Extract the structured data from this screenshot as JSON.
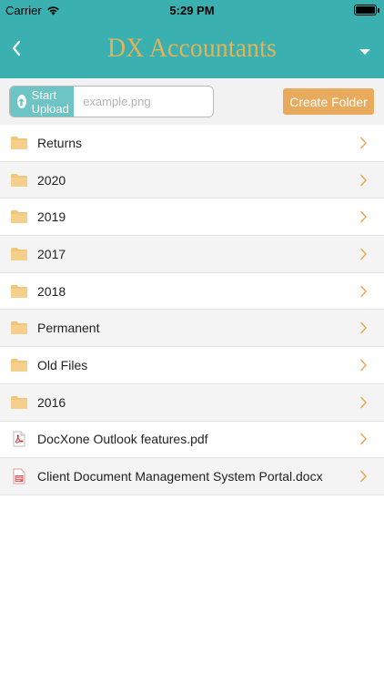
{
  "status_bar": {
    "carrier": "Carrier",
    "time": "5:29 PM",
    "battery_level": 1.0
  },
  "nav": {
    "title": "DX Accountants",
    "back_icon": "chevron-left-icon",
    "menu_icon": "caret-down-icon"
  },
  "toolbar": {
    "upload_label": "Start Upload",
    "file_placeholder": "example.png",
    "create_folder_label": "Create Folder"
  },
  "colors": {
    "header": "#3bb0b0",
    "title_gold": "#e3b25a",
    "upload_button": "#6cc4c4",
    "create_folder_button": "#e8aa5c",
    "folder_icon": "#f0c77a",
    "chevron": "#e8aa5c"
  },
  "items": [
    {
      "label": "Returns",
      "type": "folder"
    },
    {
      "label": "2020",
      "type": "folder"
    },
    {
      "label": "2019",
      "type": "folder"
    },
    {
      "label": "2017",
      "type": "folder"
    },
    {
      "label": "2018",
      "type": "folder"
    },
    {
      "label": "Permanent",
      "type": "folder"
    },
    {
      "label": "Old Files",
      "type": "folder"
    },
    {
      "label": "2016",
      "type": "folder"
    },
    {
      "label": "DocXone Outlook features.pdf",
      "type": "pdf"
    },
    {
      "label": "Client Document Management System Portal.docx",
      "type": "docx"
    }
  ]
}
